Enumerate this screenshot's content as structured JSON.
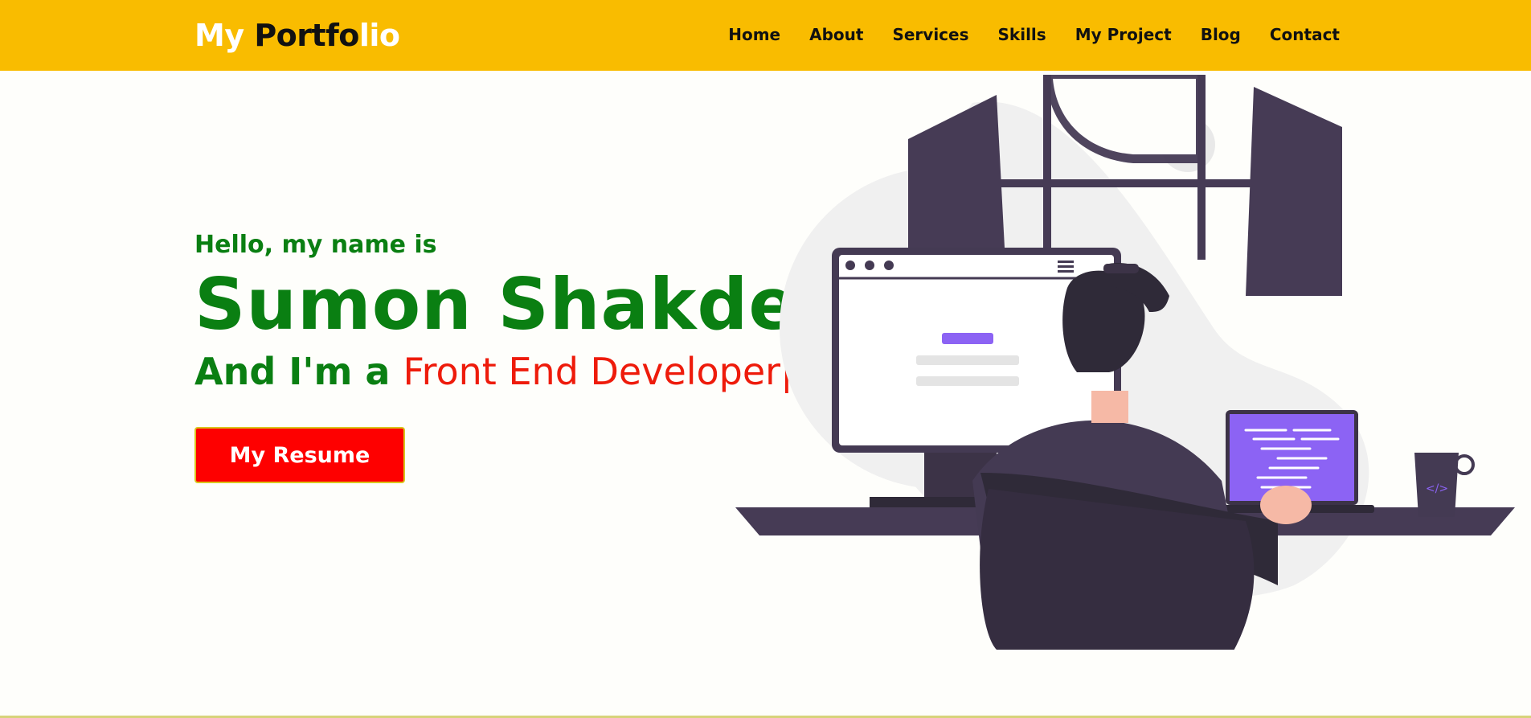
{
  "header": {
    "logo_part1": "My ",
    "logo_part2": "Portfo",
    "logo_part3": "lio",
    "background": "#f9bc00"
  },
  "nav": {
    "items": [
      "Home",
      "About",
      "Services",
      "Skills",
      "My Project",
      "Blog",
      "Contact"
    ]
  },
  "hero": {
    "greeting": "Hello, my name is",
    "name": "Sumon Shakder",
    "role_prefix": "And I'm a ",
    "role_typed": "Front End Developer",
    "cursor": "|",
    "resume_button": "My Resume"
  },
  "colors": {
    "accent_green": "#0a7f12",
    "accent_red": "#ee1b0b",
    "button_red": "#fe0000",
    "laptop_purple": "#8c63f4",
    "dark_purple": "#443a53"
  },
  "illustration": {
    "icons": [
      "monitor-icon",
      "laptop-icon",
      "mug-icon",
      "person-at-desk"
    ],
    "mug_label": "</>"
  }
}
